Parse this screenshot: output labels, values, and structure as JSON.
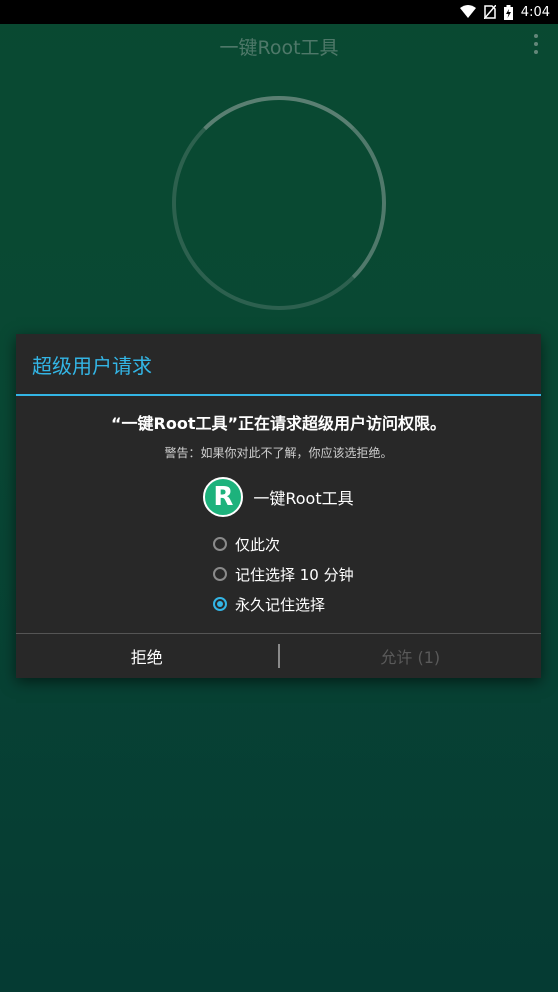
{
  "status_bar": {
    "time": "4:04",
    "icons": [
      "wifi-icon",
      "no-sim-icon",
      "battery-charging-icon"
    ]
  },
  "app_bar": {
    "title": "一键Root工具",
    "menu_icon": "overflow-menu-icon"
  },
  "dialog": {
    "title": "超级用户请求",
    "request_text": "“一键Root工具”正在请求超级用户访问权限。",
    "warning_text": "警告：如果你对此不了解，你应该选拒绝。",
    "app_icon_letter": "R",
    "app_name": "一键Root工具",
    "options": [
      {
        "label": "仅此次",
        "checked": false
      },
      {
        "label": "记住选择 10 分钟",
        "checked": false
      },
      {
        "label": "永久记住选择",
        "checked": true
      }
    ],
    "deny_label": "拒绝",
    "allow_label": "允许 (1)"
  },
  "colors": {
    "accent": "#33b5e5",
    "background_top": "#0c5a3c",
    "background_bottom": "#07483f",
    "dialog_bg": "#282828",
    "app_icon_bg": "#1db27c"
  }
}
